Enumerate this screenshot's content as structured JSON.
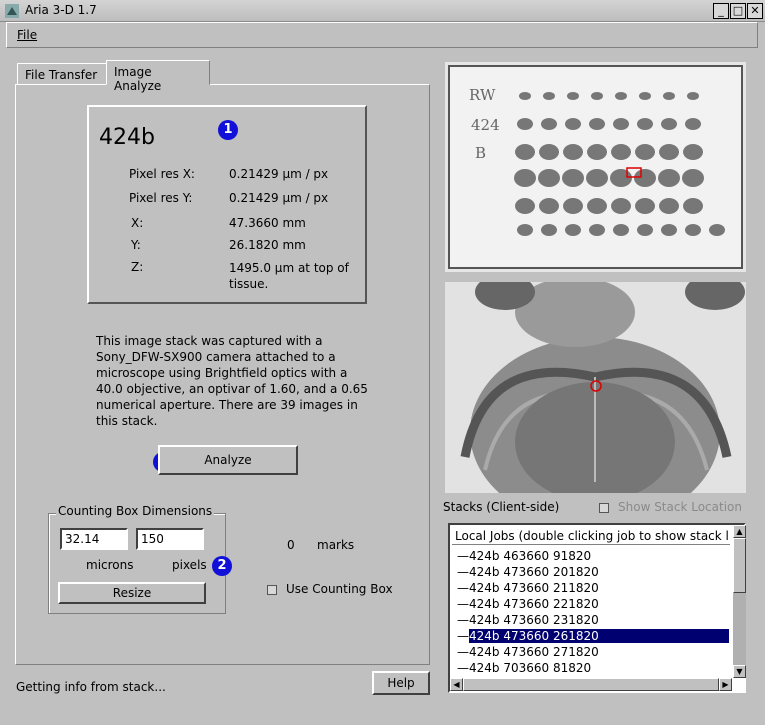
{
  "window": {
    "title": "Aria 3-D 1.7"
  },
  "menu": {
    "file_label": "File"
  },
  "tabs": [
    {
      "label": "File Transfer"
    },
    {
      "label": "Image Analyze"
    }
  ],
  "info": {
    "stack_name": "424b",
    "rows": [
      {
        "label": "Pixel res X:",
        "value": "0.21429 µm / px"
      },
      {
        "label": "Pixel res Y:",
        "value": "0.21429 µm / px"
      },
      {
        "label": "X:",
        "value": "47.3660 mm"
      },
      {
        "label": "Y:",
        "value": "26.1820 mm"
      },
      {
        "label": "Z:",
        "value": "1495.0 µm at top of tissue."
      }
    ]
  },
  "markers": [
    "1",
    "2",
    "3"
  ],
  "description": "This image stack was captured with a Sony_DFW-SX900 camera attached to a microscope using Brightfield optics with a 40.0 objective, an optivar of 1.60, and a 0.65 numerical aperture. There are 39 images in this stack.",
  "analyze_label": "Analyze",
  "counting": {
    "legend": "Counting Box Dimensions",
    "microns_value": "32.14",
    "pixels_value": "150",
    "microns_label": "microns",
    "pixels_label": "pixels",
    "resize_label": "Resize",
    "marks_count": "0",
    "marks_label": "marks",
    "use_counting_box_label": "Use Counting Box"
  },
  "slide_labels": {
    "line1": "RW",
    "line2": "424",
    "line3": "B"
  },
  "stacks": {
    "label": "Stacks (Client-side)",
    "show_location_label": "Show Stack Location",
    "list_header": "Local Jobs (double clicking job to show stack list)",
    "items": [
      "424b 463660 91820",
      "424b 473660 201820",
      "424b 473660 211820",
      "424b 473660 221820",
      "424b 473660 231820",
      "424b 473660 261820",
      "424b 473660 271820",
      "424b 703660 81820"
    ],
    "selected_index": 5
  },
  "help_label": "Help",
  "status": "Getting info from stack...",
  "colors": {
    "selection": "#000070",
    "marker": "#1010d8",
    "background": "#c0c0c0"
  }
}
